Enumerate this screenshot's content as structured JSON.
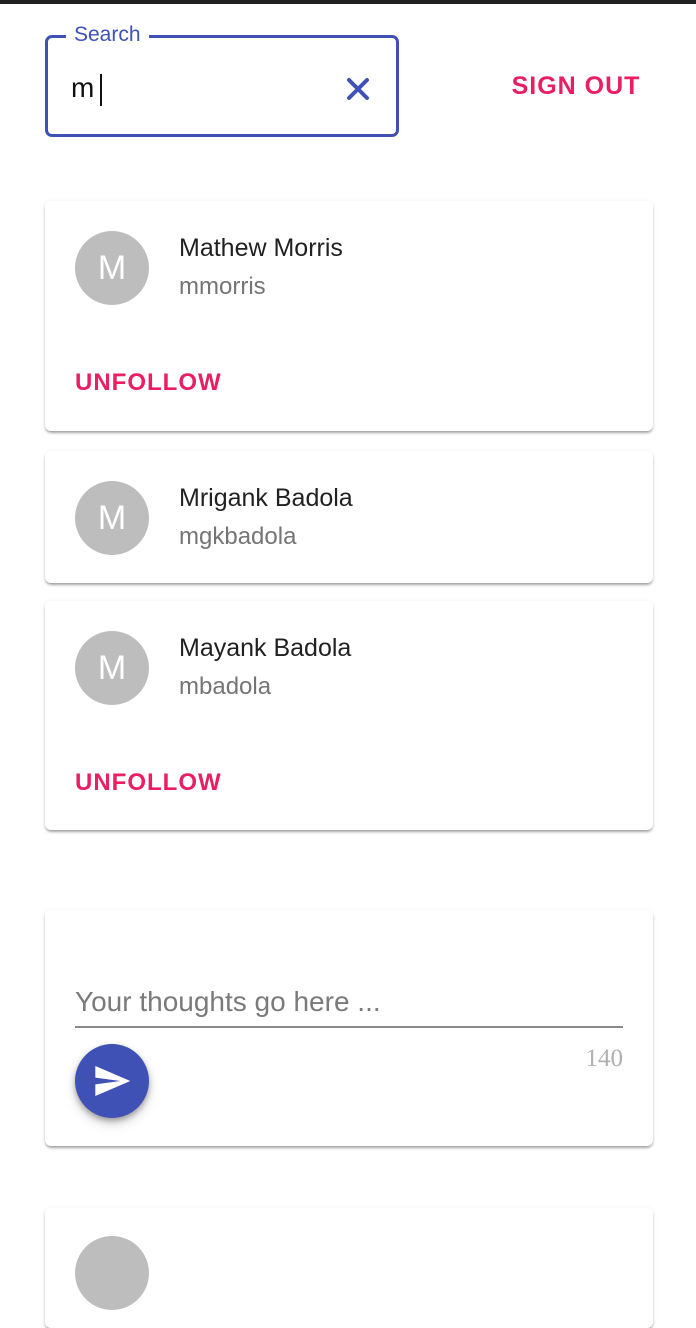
{
  "search": {
    "label": "Search",
    "value": "m",
    "clear_icon": "close-icon"
  },
  "header": {
    "sign_out_label": "SIGN OUT"
  },
  "users": [
    {
      "initial": "M",
      "name": "Mathew Morris",
      "handle": "mmorris",
      "action": "UNFOLLOW"
    },
    {
      "initial": "M",
      "name": "Mrigank Badola",
      "handle": "mgkbadola"
    },
    {
      "initial": "M",
      "name": "Mayank Badola",
      "handle": "mbadola",
      "action": "UNFOLLOW"
    }
  ],
  "compose": {
    "placeholder": "Your thoughts go here ...",
    "char_count": "140",
    "send_icon": "send-icon"
  },
  "colors": {
    "primary": "#3f51b5",
    "accent": "#e91e63",
    "avatar": "#bdbdbd"
  }
}
